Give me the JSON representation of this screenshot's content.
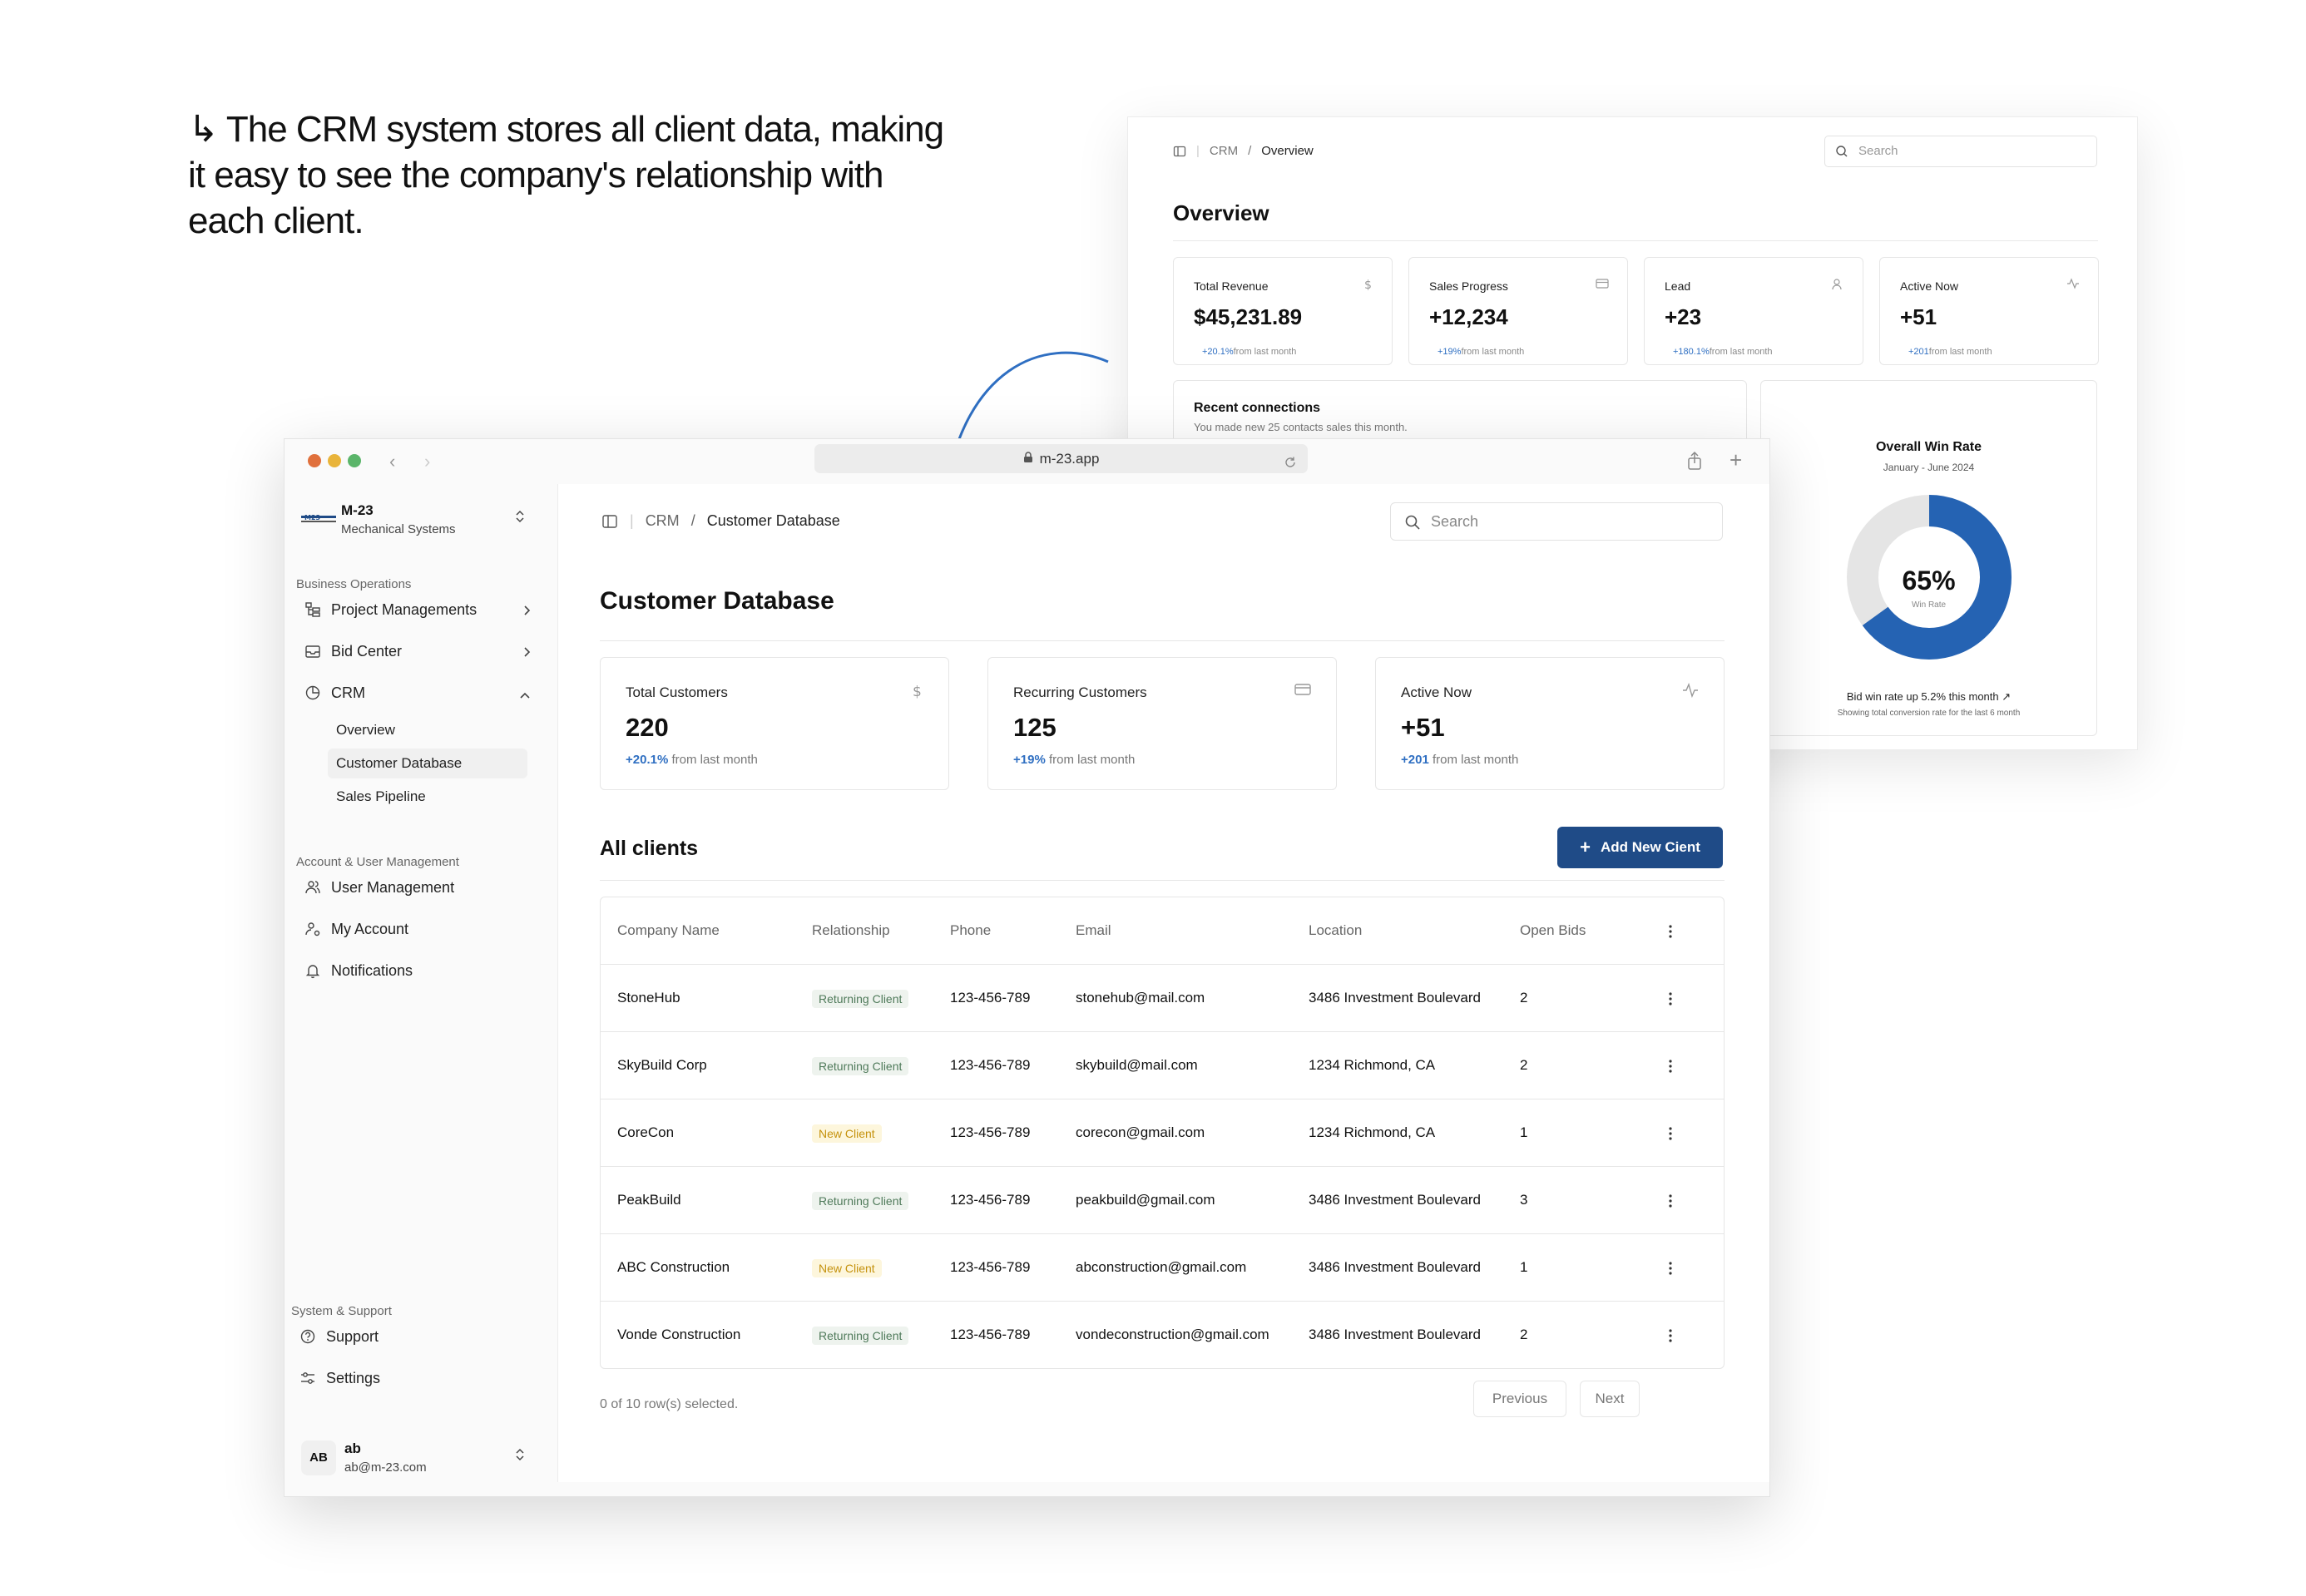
{
  "headline": "The CRM system stores all client data, making it easy to see the company's relationship with each client.",
  "overview_window": {
    "breadcrumb": {
      "root": "CRM",
      "current": "Overview"
    },
    "search_placeholder": "Search",
    "title": "Overview",
    "cards": [
      {
        "label": "Total Revenue",
        "value": "$45,231.89",
        "delta": "+20.1%",
        "delta_text": "from last month",
        "icon": "dollar-icon"
      },
      {
        "label": "Sales Progress",
        "value": "+12,234",
        "delta": "+19%",
        "delta_text": "from last month",
        "icon": "card-icon"
      },
      {
        "label": "Lead",
        "value": "+23",
        "delta": "+180.1%",
        "delta_text": "from last month",
        "icon": "user-icon"
      },
      {
        "label": "Active Now",
        "value": "+51",
        "delta": "+201",
        "delta_text": "from last month",
        "icon": "activity-icon"
      }
    ],
    "recent": {
      "title": "Recent connections",
      "subtitle": "You made new 25 contacts sales this month."
    },
    "win_rate": {
      "title": "Overall Win Rate",
      "period": "January - June 2024",
      "percent_label": "65%",
      "percent_value": 65,
      "caption": "Win Rate",
      "footer": "Bid win rate up 5.2% this month",
      "footnote": "Showing total conversion rate for the last 6 month",
      "fill_color": "#2563b3",
      "track_color": "#e5e5e5"
    }
  },
  "browser": {
    "url": "m-23.app",
    "traffic_lights": [
      "#e0703c",
      "#e9b43a",
      "#5bb56a"
    ]
  },
  "sidebar": {
    "brand_name": "M-23",
    "brand_sub": "Mechanical Systems",
    "sections": {
      "business": "Business Operations",
      "account": "Account & User Management",
      "system": "System & Support"
    },
    "business_items": [
      "Project Managements",
      "Bid Center",
      "CRM"
    ],
    "crm_sub": [
      "Overview",
      "Customer Database",
      "Sales Pipeline"
    ],
    "account_items": [
      "User Management",
      "My Account",
      "Notifications"
    ],
    "system_items": [
      "Support",
      "Settings"
    ],
    "user": {
      "initials": "AB",
      "name": "ab",
      "email": "ab@m-23.com"
    }
  },
  "main": {
    "breadcrumb": {
      "root": "CRM",
      "current": "Customer Database"
    },
    "search_placeholder": "Search",
    "title": "Customer Database",
    "stats": [
      {
        "label": "Total Customers",
        "value": "220",
        "delta": "+20.1%",
        "delta_text": "from last month",
        "icon": "dollar-icon"
      },
      {
        "label": "Recurring Customers",
        "value": "125",
        "delta": "+19%",
        "delta_text": "from last month",
        "icon": "card-icon"
      },
      {
        "label": "Active Now",
        "value": "+51",
        "delta": "+201",
        "delta_text": "from last month",
        "icon": "activity-icon"
      }
    ],
    "all_clients": "All clients",
    "add_button": "Add New Cient",
    "columns": [
      "Company Name",
      "Relationship",
      "Phone",
      "Email",
      "Location",
      "Open Bids"
    ],
    "rows": [
      {
        "company": "StoneHub",
        "relationship": "Returning Client",
        "type": "ret",
        "phone": "123-456-789",
        "email": "stonehub@mail.com",
        "location": "3486 Investment Boulevard",
        "bids": "2"
      },
      {
        "company": "SkyBuild Corp",
        "relationship": "Returning Client",
        "type": "ret",
        "phone": "123-456-789",
        "email": "skybuild@mail.com",
        "location": "1234 Richmond, CA",
        "bids": "2"
      },
      {
        "company": "CoreCon",
        "relationship": "New Client",
        "type": "new",
        "phone": "123-456-789",
        "email": "corecon@gmail.com",
        "location": "1234 Richmond, CA",
        "bids": "1"
      },
      {
        "company": "PeakBuild",
        "relationship": "Returning Client",
        "type": "ret",
        "phone": "123-456-789",
        "email": "peakbuild@gmail.com",
        "location": "3486 Investment Boulevard",
        "bids": "3"
      },
      {
        "company": "ABC Construction",
        "relationship": "New Client",
        "type": "new",
        "phone": "123-456-789",
        "email": "abconstruction@gmail.com",
        "location": "3486 Investment Boulevard",
        "bids": "1"
      },
      {
        "company": "Vonde Construction",
        "relationship": "Returning Client",
        "type": "ret",
        "phone": "123-456-789",
        "email": "vondeconstruction@gmail.com",
        "location": "3486 Investment Boulevard",
        "bids": "2"
      }
    ],
    "selection": "0 of 10 row(s) selected.",
    "prev": "Previous",
    "next": "Next"
  }
}
